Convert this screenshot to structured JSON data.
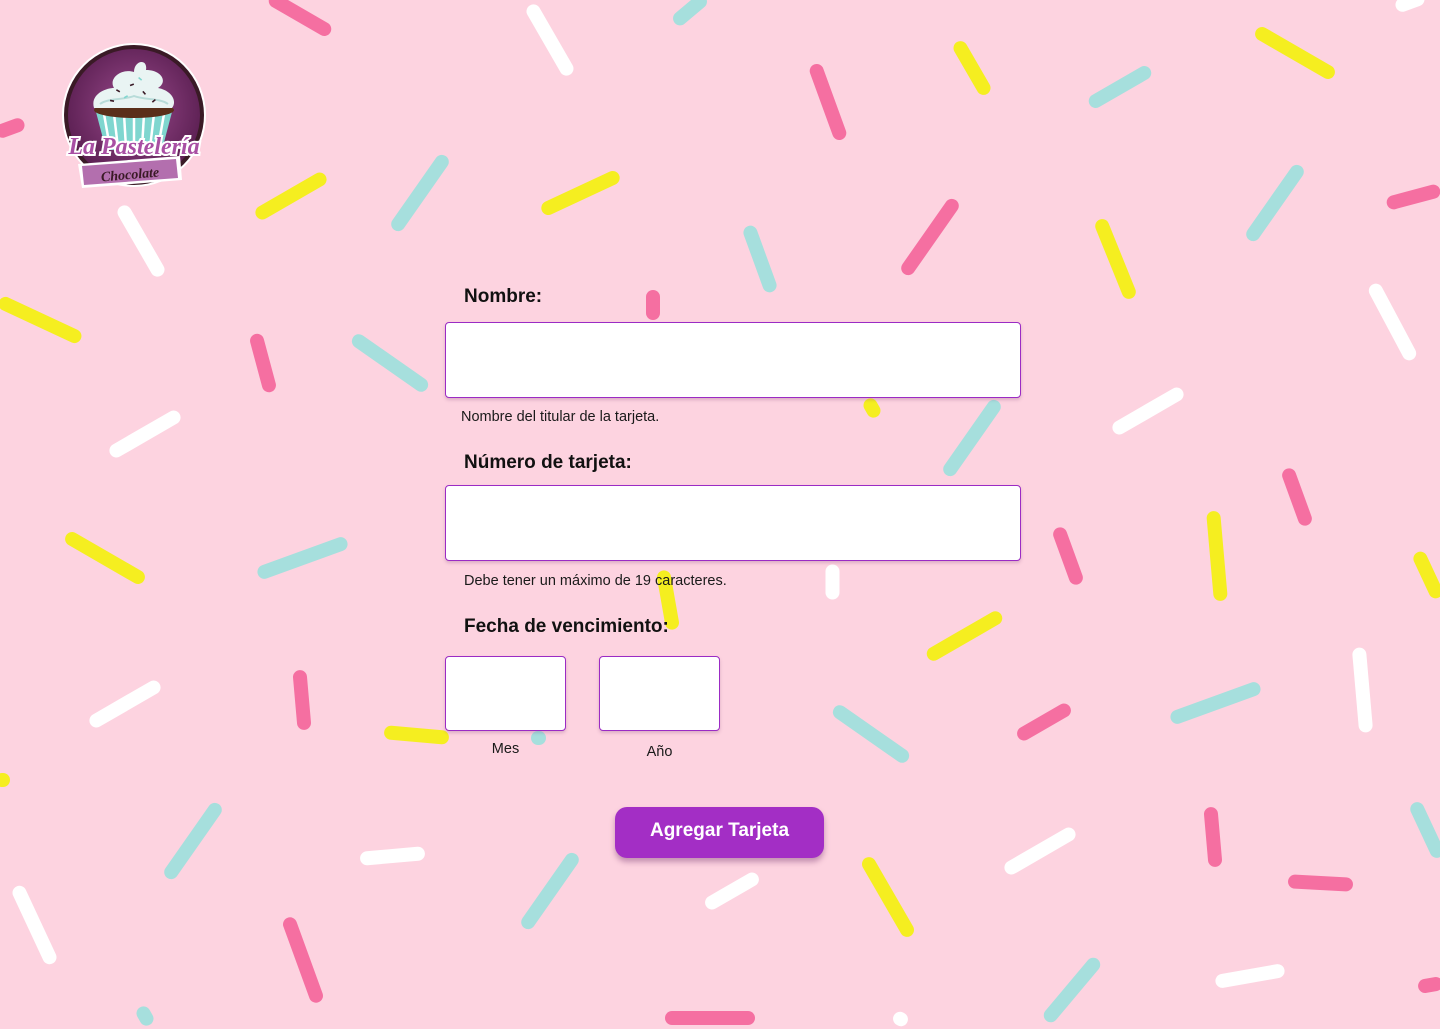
{
  "brand": {
    "name": "La Pastelería",
    "tagline": "Chocolate"
  },
  "colors": {
    "background": "#fdd3e0",
    "accent": "#a32ec5",
    "field_border": "#9b2bc4",
    "sprinkle_pink": "#f56fa1",
    "sprinkle_yellow": "#f5ee20",
    "sprinkle_teal": "#a6dfdd",
    "sprinkle_white": "#ffffff"
  },
  "form": {
    "name": {
      "label": "Nombre:",
      "value": "",
      "hint": "Nombre del titular de la tarjeta."
    },
    "card_number": {
      "label": "Número de tarjeta:",
      "value": "",
      "hint": "Debe tener un máximo de 19 caracteres."
    },
    "expiry": {
      "label": "Fecha de vencimiento:",
      "month": {
        "value": "",
        "label": "Mes"
      },
      "year": {
        "value": "",
        "label": "Año"
      }
    },
    "submit_label": "Agregar Tarjeta"
  }
}
